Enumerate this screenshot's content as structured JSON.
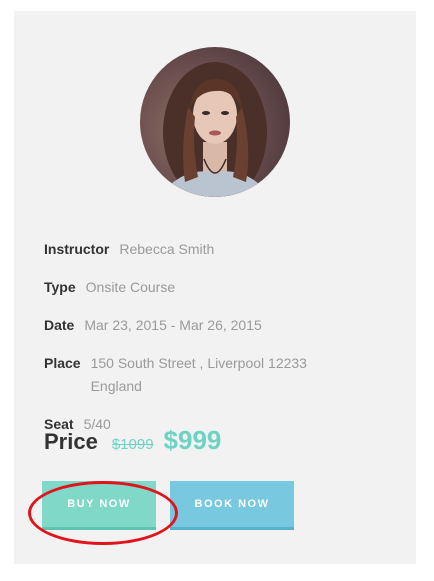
{
  "course": {
    "instructor": {
      "label": "Instructor",
      "value": "Rebecca Smith"
    },
    "type": {
      "label": "Type",
      "value": "Onsite Course"
    },
    "date": {
      "label": "Date",
      "value": "Mar 23, 2015 - Mar 26, 2015"
    },
    "place": {
      "label": "Place",
      "value": "150 South Street , Liverpool 12233 England"
    },
    "seat": {
      "label": "Seat",
      "value": "5/40"
    }
  },
  "price": {
    "label": "Price",
    "old": "$1099",
    "current": "$999"
  },
  "buttons": {
    "buy": "BUY NOW",
    "book": "BOOK NOW"
  },
  "colors": {
    "accent_teal": "#6fd3c4",
    "buy_button": "#7fd8c8",
    "book_button": "#78c8e0",
    "highlight": "#e0141c"
  },
  "icons": {
    "avatar": "instructor-avatar-photo"
  }
}
